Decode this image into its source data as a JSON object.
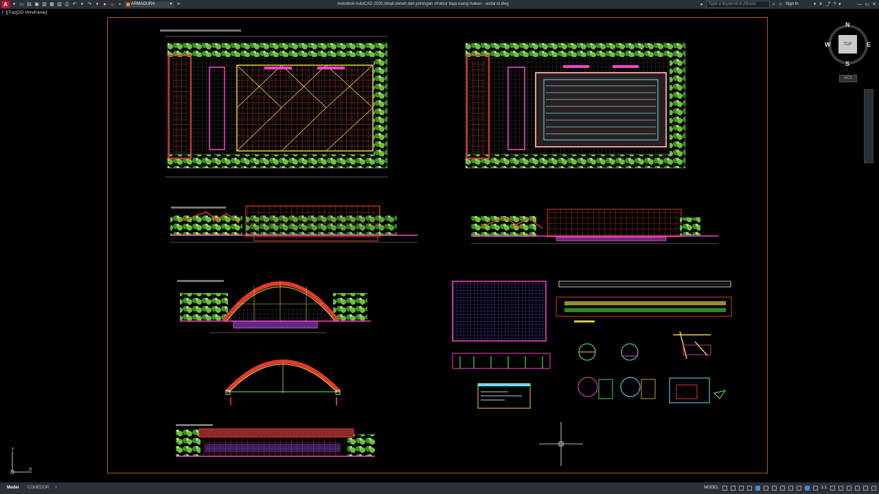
{
  "app": {
    "title": "Autodesk AutoCAD 2020   detail denah dan potongan struktur baja ruang makan - asdar.id.dwg",
    "workspace": "ARMADURA",
    "search_placeholder": "Type a keyword or phrase",
    "sign_in": "Sign In",
    "logo_letter": "A"
  },
  "viewport": {
    "label": "[−][Top][2D Wireframe]"
  },
  "viewcube": {
    "face": "TOP",
    "north": "N",
    "south": "S",
    "east": "E",
    "west": "W",
    "wcs": "WCS"
  },
  "ucs": {
    "x": "X",
    "y": "Y"
  },
  "status": {
    "tabs": [
      "Model",
      "COMEDOR"
    ],
    "add_tab": "+",
    "model_label": "MODEL",
    "scale": "1:1"
  },
  "colors": {
    "accent": "#c8102e",
    "sheet_border": "#b45a2d"
  }
}
